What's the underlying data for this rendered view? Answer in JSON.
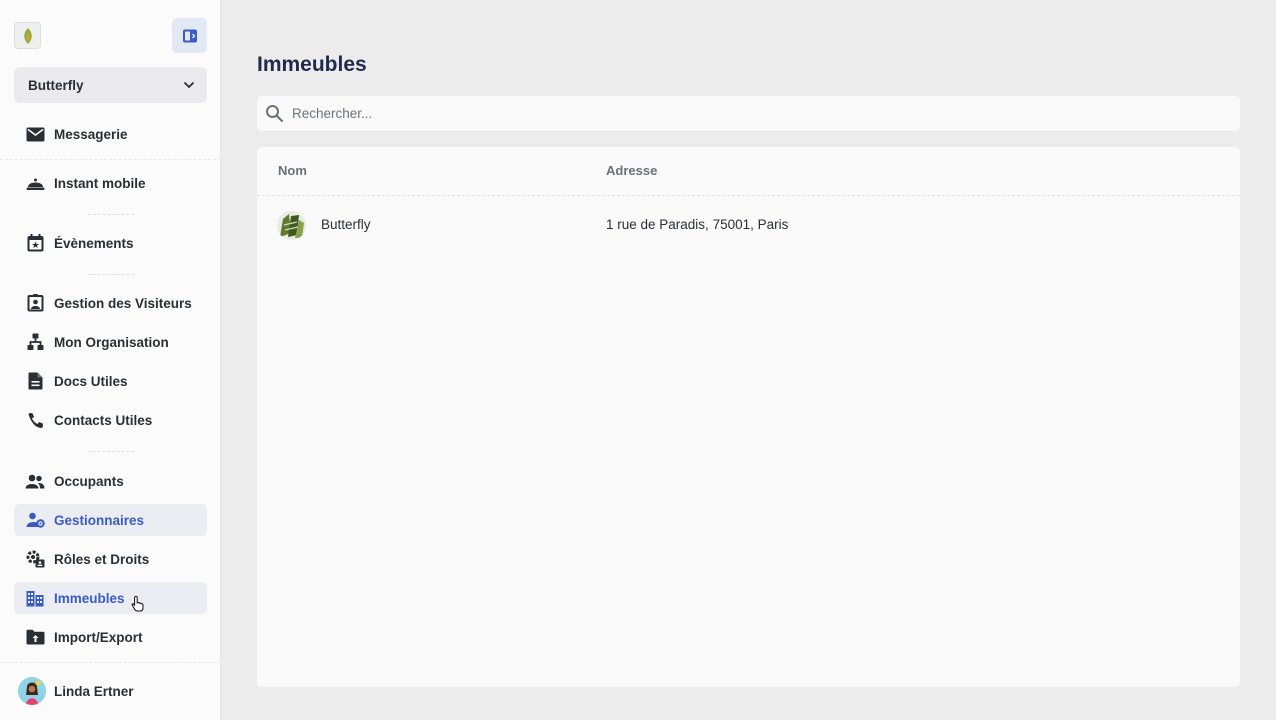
{
  "sidebar": {
    "building_select": {
      "value": "Butterfly"
    },
    "items": [
      {
        "label": "Messagerie"
      },
      {
        "label": "Instant mobile"
      },
      {
        "label": "Évènements"
      },
      {
        "label": "Gestion des Visiteurs"
      },
      {
        "label": "Mon Organisation"
      },
      {
        "label": "Docs Utiles"
      },
      {
        "label": "Contacts Utiles"
      },
      {
        "label": "Occupants"
      },
      {
        "label": "Gestionnaires"
      },
      {
        "label": "Rôles et Droits"
      },
      {
        "label": "Immeubles"
      },
      {
        "label": "Import/Export"
      }
    ],
    "profile": {
      "name": "Linda Ertner"
    }
  },
  "main": {
    "title": "Immeubles",
    "search": {
      "placeholder": "Rechercher..."
    },
    "table": {
      "columns": [
        "Nom",
        "Adresse"
      ],
      "rows": [
        {
          "nom": "Butterfly",
          "adresse": "1 rue de Paradis, 75001, Paris"
        }
      ]
    }
  },
  "colors": {
    "accent": "#3b5bc4",
    "title": "#1f2a4d",
    "background": "#ececed"
  }
}
